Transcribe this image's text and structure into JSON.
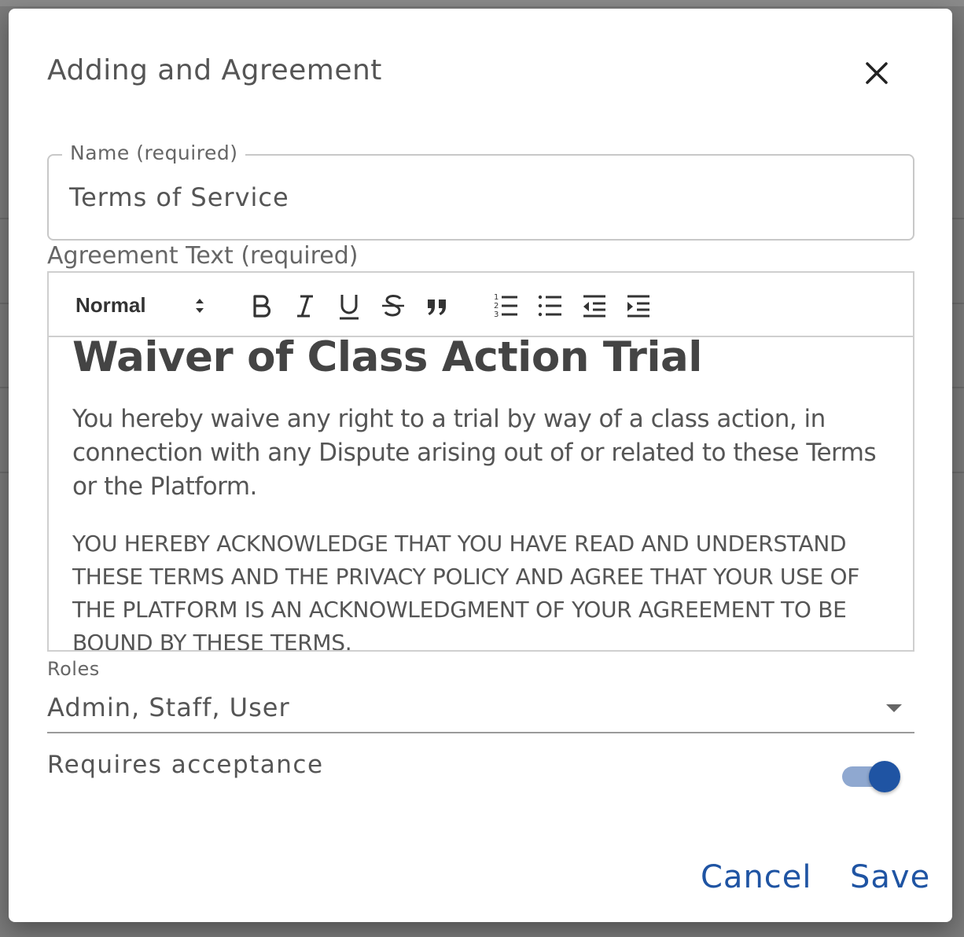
{
  "dialog": {
    "title": "Adding and Agreement",
    "close_icon": "close-icon"
  },
  "name_field": {
    "label": "Name (required)",
    "value": "Terms of Service"
  },
  "agreement": {
    "label": "Agreement Text (required)",
    "toolbar": {
      "format_value": "Normal",
      "buttons": [
        "bold-icon",
        "italic-icon",
        "underline-icon",
        "strikethrough-icon",
        "blockquote-icon",
        "ordered-list-icon",
        "bullet-list-icon",
        "outdent-icon",
        "indent-icon"
      ]
    },
    "content": {
      "heading": "Waiver of Class Action Trial",
      "paragraph1": "You hereby waive any right to a trial by way of a class action, in connection with any Dispute arising out of or related to these Terms or the Platform.",
      "paragraph2": "YOU HEREBY ACKNOWLEDGE THAT YOU HAVE READ AND UNDERSTAND THESE TERMS AND THE PRIVACY POLICY AND AGREE THAT YOUR USE OF THE PLATFORM IS AN ACKNOWLEDGMENT OF YOUR AGREEMENT TO BE BOUND BY THESE TERMS."
    }
  },
  "roles": {
    "label": "Roles",
    "value": "Admin, Staff, User"
  },
  "requires_acceptance": {
    "label": "Requires acceptance",
    "enabled": true
  },
  "actions": {
    "cancel_label": "Cancel",
    "save_label": "Save"
  },
  "colors": {
    "accent": "#1f54a3",
    "toggle_track": "#8fa8d0",
    "text": "#555555",
    "overlay": "#7a7a7a"
  }
}
